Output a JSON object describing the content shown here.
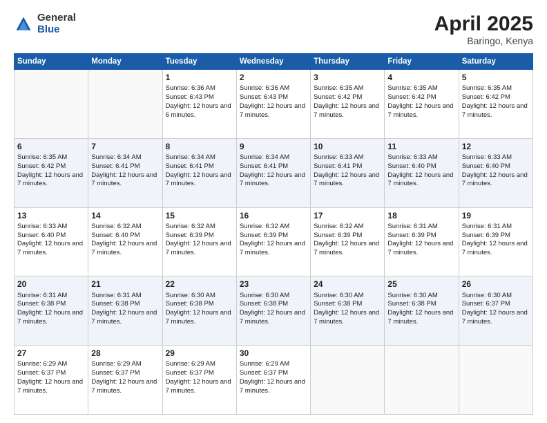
{
  "header": {
    "logo_general": "General",
    "logo_blue": "Blue",
    "month_title": "April 2025",
    "location": "Baringo, Kenya"
  },
  "days_of_week": [
    "Sunday",
    "Monday",
    "Tuesday",
    "Wednesday",
    "Thursday",
    "Friday",
    "Saturday"
  ],
  "weeks": [
    [
      {
        "day": "",
        "empty": true
      },
      {
        "day": "",
        "empty": true
      },
      {
        "day": "1",
        "sunrise": "Sunrise: 6:36 AM",
        "sunset": "Sunset: 6:43 PM",
        "daylight": "Daylight: 12 hours and 6 minutes."
      },
      {
        "day": "2",
        "sunrise": "Sunrise: 6:36 AM",
        "sunset": "Sunset: 6:43 PM",
        "daylight": "Daylight: 12 hours and 7 minutes."
      },
      {
        "day": "3",
        "sunrise": "Sunrise: 6:35 AM",
        "sunset": "Sunset: 6:42 PM",
        "daylight": "Daylight: 12 hours and 7 minutes."
      },
      {
        "day": "4",
        "sunrise": "Sunrise: 6:35 AM",
        "sunset": "Sunset: 6:42 PM",
        "daylight": "Daylight: 12 hours and 7 minutes."
      },
      {
        "day": "5",
        "sunrise": "Sunrise: 6:35 AM",
        "sunset": "Sunset: 6:42 PM",
        "daylight": "Daylight: 12 hours and 7 minutes."
      }
    ],
    [
      {
        "day": "6",
        "sunrise": "Sunrise: 6:35 AM",
        "sunset": "Sunset: 6:42 PM",
        "daylight": "Daylight: 12 hours and 7 minutes."
      },
      {
        "day": "7",
        "sunrise": "Sunrise: 6:34 AM",
        "sunset": "Sunset: 6:41 PM",
        "daylight": "Daylight: 12 hours and 7 minutes."
      },
      {
        "day": "8",
        "sunrise": "Sunrise: 6:34 AM",
        "sunset": "Sunset: 6:41 PM",
        "daylight": "Daylight: 12 hours and 7 minutes."
      },
      {
        "day": "9",
        "sunrise": "Sunrise: 6:34 AM",
        "sunset": "Sunset: 6:41 PM",
        "daylight": "Daylight: 12 hours and 7 minutes."
      },
      {
        "day": "10",
        "sunrise": "Sunrise: 6:33 AM",
        "sunset": "Sunset: 6:41 PM",
        "daylight": "Daylight: 12 hours and 7 minutes."
      },
      {
        "day": "11",
        "sunrise": "Sunrise: 6:33 AM",
        "sunset": "Sunset: 6:40 PM",
        "daylight": "Daylight: 12 hours and 7 minutes."
      },
      {
        "day": "12",
        "sunrise": "Sunrise: 6:33 AM",
        "sunset": "Sunset: 6:40 PM",
        "daylight": "Daylight: 12 hours and 7 minutes."
      }
    ],
    [
      {
        "day": "13",
        "sunrise": "Sunrise: 6:33 AM",
        "sunset": "Sunset: 6:40 PM",
        "daylight": "Daylight: 12 hours and 7 minutes."
      },
      {
        "day": "14",
        "sunrise": "Sunrise: 6:32 AM",
        "sunset": "Sunset: 6:40 PM",
        "daylight": "Daylight: 12 hours and 7 minutes."
      },
      {
        "day": "15",
        "sunrise": "Sunrise: 6:32 AM",
        "sunset": "Sunset: 6:39 PM",
        "daylight": "Daylight: 12 hours and 7 minutes."
      },
      {
        "day": "16",
        "sunrise": "Sunrise: 6:32 AM",
        "sunset": "Sunset: 6:39 PM",
        "daylight": "Daylight: 12 hours and 7 minutes."
      },
      {
        "day": "17",
        "sunrise": "Sunrise: 6:32 AM",
        "sunset": "Sunset: 6:39 PM",
        "daylight": "Daylight: 12 hours and 7 minutes."
      },
      {
        "day": "18",
        "sunrise": "Sunrise: 6:31 AM",
        "sunset": "Sunset: 6:39 PM",
        "daylight": "Daylight: 12 hours and 7 minutes."
      },
      {
        "day": "19",
        "sunrise": "Sunrise: 6:31 AM",
        "sunset": "Sunset: 6:39 PM",
        "daylight": "Daylight: 12 hours and 7 minutes."
      }
    ],
    [
      {
        "day": "20",
        "sunrise": "Sunrise: 6:31 AM",
        "sunset": "Sunset: 6:38 PM",
        "daylight": "Daylight: 12 hours and 7 minutes."
      },
      {
        "day": "21",
        "sunrise": "Sunrise: 6:31 AM",
        "sunset": "Sunset: 6:38 PM",
        "daylight": "Daylight: 12 hours and 7 minutes."
      },
      {
        "day": "22",
        "sunrise": "Sunrise: 6:30 AM",
        "sunset": "Sunset: 6:38 PM",
        "daylight": "Daylight: 12 hours and 7 minutes."
      },
      {
        "day": "23",
        "sunrise": "Sunrise: 6:30 AM",
        "sunset": "Sunset: 6:38 PM",
        "daylight": "Daylight: 12 hours and 7 minutes."
      },
      {
        "day": "24",
        "sunrise": "Sunrise: 6:30 AM",
        "sunset": "Sunset: 6:38 PM",
        "daylight": "Daylight: 12 hours and 7 minutes."
      },
      {
        "day": "25",
        "sunrise": "Sunrise: 6:30 AM",
        "sunset": "Sunset: 6:38 PM",
        "daylight": "Daylight: 12 hours and 7 minutes."
      },
      {
        "day": "26",
        "sunrise": "Sunrise: 6:30 AM",
        "sunset": "Sunset: 6:37 PM",
        "daylight": "Daylight: 12 hours and 7 minutes."
      }
    ],
    [
      {
        "day": "27",
        "sunrise": "Sunrise: 6:29 AM",
        "sunset": "Sunset: 6:37 PM",
        "daylight": "Daylight: 12 hours and 7 minutes."
      },
      {
        "day": "28",
        "sunrise": "Sunrise: 6:29 AM",
        "sunset": "Sunset: 6:37 PM",
        "daylight": "Daylight: 12 hours and 7 minutes."
      },
      {
        "day": "29",
        "sunrise": "Sunrise: 6:29 AM",
        "sunset": "Sunset: 6:37 PM",
        "daylight": "Daylight: 12 hours and 7 minutes."
      },
      {
        "day": "30",
        "sunrise": "Sunrise: 6:29 AM",
        "sunset": "Sunset: 6:37 PM",
        "daylight": "Daylight: 12 hours and 7 minutes."
      },
      {
        "day": "",
        "empty": true
      },
      {
        "day": "",
        "empty": true
      },
      {
        "day": "",
        "empty": true
      }
    ]
  ]
}
